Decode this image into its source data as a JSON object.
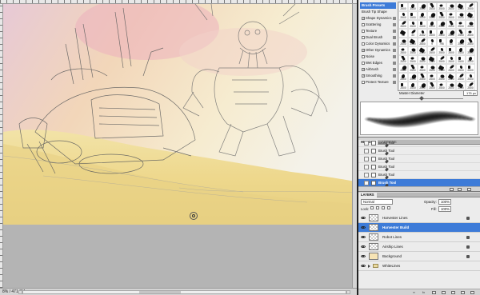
{
  "document": {
    "status_zoom": "8% / 471.6M"
  },
  "colors": {
    "selection": "#3d7bd8",
    "sand": "#ecd98a",
    "sky_pink": "#efb7c0",
    "canvas_bg": "#f7f4ea"
  },
  "brushes": {
    "tab_label": "Brush Presets",
    "options": [
      {
        "label": "Brush Tip Shape",
        "checkbox": false
      },
      {
        "label": "Shape Dynamics",
        "checkbox": true,
        "checked": true
      },
      {
        "label": "Scattering",
        "checkbox": true,
        "checked": false
      },
      {
        "label": "Texture",
        "checkbox": true,
        "checked": false
      },
      {
        "label": "Dual Brush",
        "checkbox": true,
        "checked": false
      },
      {
        "label": "Color Dynamics",
        "checkbox": true,
        "checked": false
      },
      {
        "label": "Other Dynamics",
        "checkbox": true,
        "checked": true
      },
      {
        "label": "Noise",
        "checkbox": true,
        "checked": false
      },
      {
        "label": "Wet Edges",
        "checkbox": true,
        "checked": false
      },
      {
        "label": "Airbrush",
        "checkbox": true,
        "checked": true
      },
      {
        "label": "Smoothing",
        "checkbox": true,
        "checked": true
      },
      {
        "label": "Protect Texture",
        "checkbox": true,
        "checked": false
      }
    ],
    "preset_sizes": [
      "2500",
      "2500",
      "2500",
      "2500",
      "2500",
      "2500",
      "2500",
      "2500",
      "2500",
      "2500",
      "2500",
      "2500",
      "2500",
      "2500",
      "2500",
      "2500",
      "2500",
      "2500",
      "2500",
      "2500",
      "2500",
      "2500",
      "2500",
      "2500",
      "56",
      "33",
      "2452",
      "2500",
      "2500",
      "2500",
      "2500",
      "2500",
      "2500",
      "2500",
      "2500",
      "9",
      "795",
      "50",
      "2500",
      "2500",
      "2500",
      "2500",
      "2500",
      "2500",
      "2500",
      "2500",
      "2500",
      "2500",
      "2500",
      "2500",
      "2500",
      "2500",
      "2500",
      "2500",
      "2500",
      "2500",
      "2500",
      "2500",
      "2500",
      "2500",
      "2500",
      "2500",
      "2500",
      "2500",
      "2500",
      "2500",
      "2500",
      "2500",
      "2500",
      "2500",
      "2500",
      "2500",
      "2500",
      "2500",
      "2500",
      "2500",
      "2500",
      "2500",
      "2500",
      "2500"
    ],
    "master_diameter_label": "Master Diameter",
    "master_diameter_value": "175 px"
  },
  "history": {
    "tabs": [
      "HISTORY",
      "ACTIONS"
    ],
    "items": [
      "Brush Tool",
      "Brush Tool",
      "Brush Tool",
      "Brush Tool",
      "Brush Tool",
      "Brush Tool"
    ],
    "active_index": 5
  },
  "layers": {
    "tab_label": "LAYERS",
    "blend_mode": "Normal",
    "opacity_label": "Opacity:",
    "opacity_value": "100%",
    "lock_label": "Lock:",
    "fill_label": "Fill:",
    "fill_value": "100%",
    "items": [
      {
        "name": "Harvester Lines",
        "selected": false,
        "locked": true,
        "type": "layer"
      },
      {
        "name": "Harvester Build",
        "selected": true,
        "locked": false,
        "type": "layer"
      },
      {
        "name": "Robot Lines",
        "selected": false,
        "locked": true,
        "type": "layer"
      },
      {
        "name": "Airship Lines",
        "selected": false,
        "locked": true,
        "type": "layer"
      },
      {
        "name": "Background",
        "selected": false,
        "locked": true,
        "type": "background"
      },
      {
        "name": "WhiteLines",
        "selected": false,
        "locked": false,
        "type": "group"
      }
    ]
  }
}
